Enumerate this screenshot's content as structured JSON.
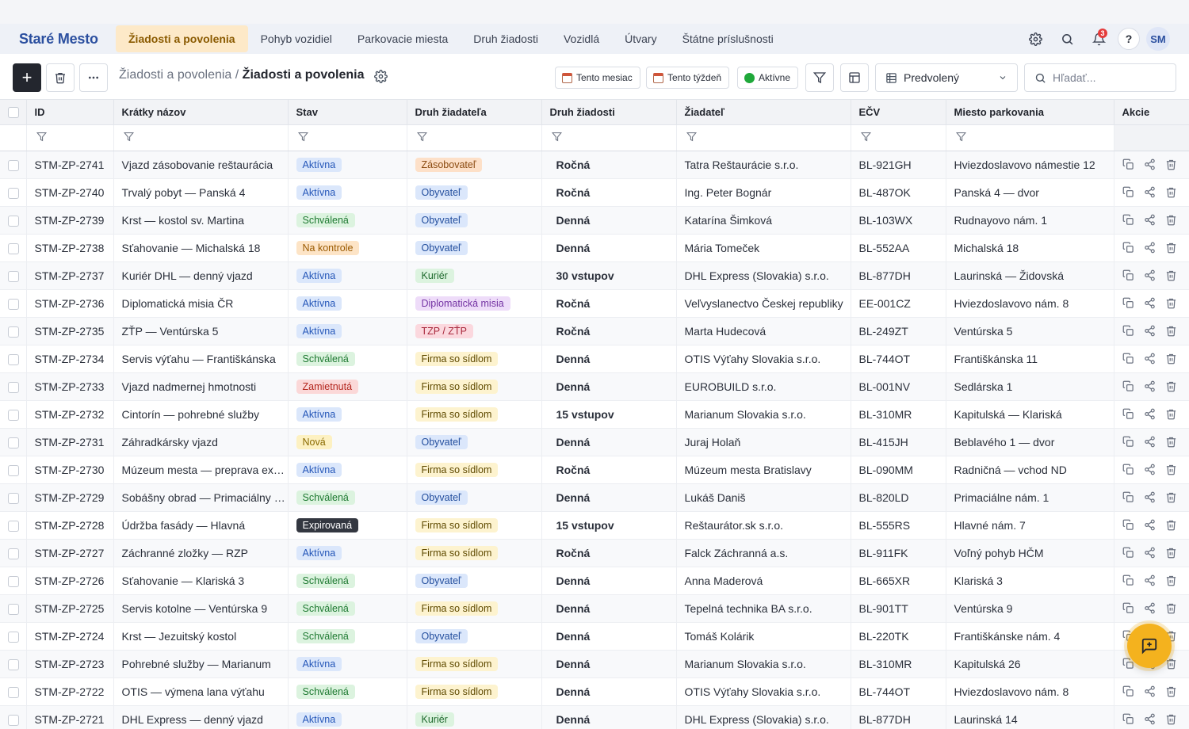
{
  "brand": "Staré Mesto",
  "nav": {
    "tabs": [
      {
        "label": "Žiadosti a povolenia",
        "active": true
      },
      {
        "label": "Pohyb vozidiel"
      },
      {
        "label": "Parkovacie miesta"
      },
      {
        "label": "Druh žiadosti"
      },
      {
        "label": "Vozidlá"
      },
      {
        "label": "Útvary"
      },
      {
        "label": "Štátne príslušnosti"
      }
    ],
    "notifications_count": "3",
    "help_label": "?",
    "avatar_initials": "SM"
  },
  "toolbar": {
    "add_label": "+",
    "breadcrumb_parent": "Žiadosti a povolenia",
    "breadcrumb_separator": "/",
    "breadcrumb_current": "Žiadosti a povolenia",
    "chip_month": "Tento mesiac",
    "chip_week": "Tento týždeň",
    "chip_active": "Aktívne",
    "view_label": "Predvolený",
    "search_placeholder": "Hľadať..."
  },
  "table": {
    "columns": [
      "ID",
      "Krátky názov",
      "Stav",
      "Druh žiadateľa",
      "Druh žiadosti",
      "Žiadateľ",
      "EČV",
      "Miesto parkovania",
      "Akcie"
    ],
    "rows": [
      {
        "id": "STM-ZP-2741",
        "name": "Vjazd zásobovanie reštaurácia",
        "stav": "Aktívna",
        "druh": "Zásobovateľ",
        "typ": "Ročná",
        "ziadatel": "Tatra Reštaurácie s.r.o.",
        "ecv": "BL-921GH",
        "miesto": "Hviezdoslavovo námestie 12"
      },
      {
        "id": "STM-ZP-2740",
        "name": "Trvalý pobyt — Panská 4",
        "stav": "Aktívna",
        "druh": "Obyvateľ",
        "typ": "Ročná",
        "ziadatel": "Ing. Peter Bognár",
        "ecv": "BL-487OK",
        "miesto": "Panská 4 — dvor"
      },
      {
        "id": "STM-ZP-2739",
        "name": "Krst — kostol sv. Martina",
        "stav": "Schválená",
        "druh": "Obyvateľ",
        "typ": "Denná",
        "ziadatel": "Katarína Šimková",
        "ecv": "BL-103WX",
        "miesto": "Rudnayovo nám. 1"
      },
      {
        "id": "STM-ZP-2738",
        "name": "Sťahovanie — Michalská 18",
        "stav": "Na kontrole",
        "druh": "Obyvateľ",
        "typ": "Denná",
        "ziadatel": "Mária Tomeček",
        "ecv": "BL-552AA",
        "miesto": "Michalská 18"
      },
      {
        "id": "STM-ZP-2737",
        "name": "Kuriér DHL — denný vjazd",
        "stav": "Aktívna",
        "druh": "Kuriér",
        "typ": "30 vstupov",
        "ziadatel": "DHL Express (Slovakia) s.r.o.",
        "ecv": "BL-877DH",
        "miesto": "Laurinská — Židovská"
      },
      {
        "id": "STM-ZP-2736",
        "name": "Diplomatická misia ČR",
        "stav": "Aktívna",
        "druh": "Diplomatická misia",
        "typ": "Ročná",
        "ziadatel": "Veľvyslanectvo Českej republiky",
        "ecv": "EE-001CZ",
        "miesto": "Hviezdoslavovo nám. 8"
      },
      {
        "id": "STM-ZP-2735",
        "name": "ZŤP — Ventúrska 5",
        "stav": "Aktívna",
        "druh": "TZP / ZŤP",
        "typ": "Ročná",
        "ziadatel": "Marta Hudecová",
        "ecv": "BL-249ZT",
        "miesto": "Ventúrska 5"
      },
      {
        "id": "STM-ZP-2734",
        "name": "Servis výťahu — Františkánska",
        "stav": "Schválená",
        "druh": "Firma so sídlom",
        "typ": "Denná",
        "ziadatel": "OTIS Výťahy Slovakia s.r.o.",
        "ecv": "BL-744OT",
        "miesto": "Františkánska 11"
      },
      {
        "id": "STM-ZP-2733",
        "name": "Vjazd nadmernej hmotnosti",
        "stav": "Zamietnutá",
        "druh": "Firma so sídlom",
        "typ": "Denná",
        "ziadatel": "EUROBUILD s.r.o.",
        "ecv": "BL-001NV",
        "miesto": "Sedlárska 1"
      },
      {
        "id": "STM-ZP-2732",
        "name": "Cintorín — pohrebné služby",
        "stav": "Aktívna",
        "druh": "Firma so sídlom",
        "typ": "15 vstupov",
        "ziadatel": "Marianum Slovakia s.r.o.",
        "ecv": "BL-310MR",
        "miesto": "Kapitulská — Klariská"
      },
      {
        "id": "STM-ZP-2731",
        "name": "Záhradkársky vjazd",
        "stav": "Nová",
        "druh": "Obyvateľ",
        "typ": "Denná",
        "ziadatel": "Juraj Holaň",
        "ecv": "BL-415JH",
        "miesto": "Beblavého 1 — dvor"
      },
      {
        "id": "STM-ZP-2730",
        "name": "Múzeum mesta — preprava exponátov",
        "stav": "Aktívna",
        "druh": "Firma so sídlom",
        "typ": "Ročná",
        "ziadatel": "Múzeum mesta Bratislavy",
        "ecv": "BL-090MM",
        "miesto": "Radničná — vchod ND"
      },
      {
        "id": "STM-ZP-2729",
        "name": "Sobášny obrad — Primaciálny palác",
        "stav": "Schválená",
        "druh": "Obyvateľ",
        "typ": "Denná",
        "ziadatel": "Lukáš Daniš",
        "ecv": "BL-820LD",
        "miesto": "Primaciálne nám. 1"
      },
      {
        "id": "STM-ZP-2728",
        "name": "Údržba fasády — Hlavná",
        "stav": "Expirovaná",
        "druh": "Firma so sídlom",
        "typ": "15 vstupov",
        "ziadatel": "Reštaurátor.sk s.r.o.",
        "ecv": "BL-555RS",
        "miesto": "Hlavné nám. 7"
      },
      {
        "id": "STM-ZP-2727",
        "name": "Záchranné zložky — RZP",
        "stav": "Aktívna",
        "druh": "Firma so sídlom",
        "typ": "Ročná",
        "ziadatel": "Falck Záchranná a.s.",
        "ecv": "BL-911FK",
        "miesto": "Voľný pohyb HČM"
      },
      {
        "id": "STM-ZP-2726",
        "name": "Sťahovanie — Klariská 3",
        "stav": "Schválená",
        "druh": "Obyvateľ",
        "typ": "Denná",
        "ziadatel": "Anna Maderová",
        "ecv": "BL-665XR",
        "miesto": "Klariská 3"
      },
      {
        "id": "STM-ZP-2725",
        "name": "Servis kotolne — Ventúrska 9",
        "stav": "Schválená",
        "druh": "Firma so sídlom",
        "typ": "Denná",
        "ziadatel": "Tepelná technika BA s.r.o.",
        "ecv": "BL-901TT",
        "miesto": "Ventúrska 9"
      },
      {
        "id": "STM-ZP-2724",
        "name": "Krst — Jezuitský kostol",
        "stav": "Schválená",
        "druh": "Obyvateľ",
        "typ": "Denná",
        "ziadatel": "Tomáš Kolárik",
        "ecv": "BL-220TK",
        "miesto": "Františkánske nám. 4"
      },
      {
        "id": "STM-ZP-2723",
        "name": "Pohrebné služby — Marianum",
        "stav": "Aktívna",
        "druh": "Firma so sídlom",
        "typ": "Denná",
        "ziadatel": "Marianum Slovakia s.r.o.",
        "ecv": "BL-310MR",
        "miesto": "Kapitulská 26"
      },
      {
        "id": "STM-ZP-2722",
        "name": "OTIS — výmena lana výťahu",
        "stav": "Schválená",
        "druh": "Firma so sídlom",
        "typ": "Denná",
        "ziadatel": "OTIS Výťahy Slovakia s.r.o.",
        "ecv": "BL-744OT",
        "miesto": "Hviezdoslavovo nám. 8"
      },
      {
        "id": "STM-ZP-2721",
        "name": "DHL Express — denný vjazd",
        "stav": "Aktívna",
        "druh": "Kuriér",
        "typ": "Denná",
        "ziadatel": "DHL Express (Slovakia) s.r.o.",
        "ecv": "BL-877DH",
        "miesto": "Laurinská 14"
      }
    ]
  },
  "colors": {
    "accent": "#fde9c8",
    "brand": "#2b4f9f",
    "fab": "#f4b21e"
  }
}
